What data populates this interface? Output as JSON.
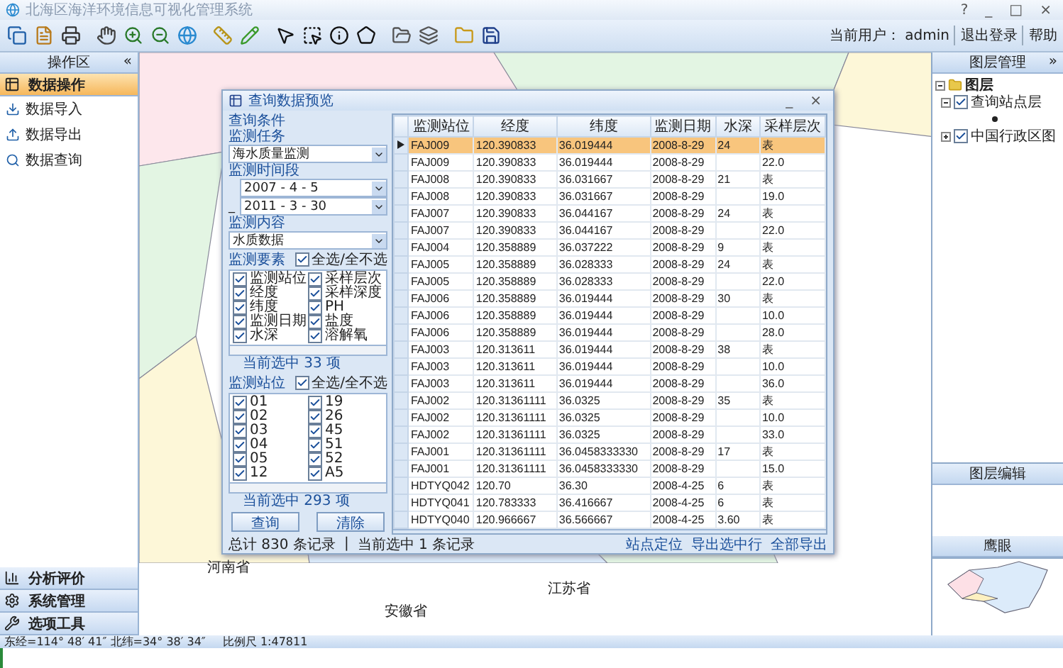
{
  "window": {
    "title": "北海区海洋环境信息可视化管理系统",
    "controls": [
      "?",
      "_",
      "□",
      "×"
    ]
  },
  "toolbar": {
    "user_label": "当前用户：",
    "user": "admin",
    "links": [
      "退出登录",
      "帮助"
    ]
  },
  "left_panel": {
    "title": "操作区",
    "collapse": "«",
    "sections": [
      {
        "label": "数据操作",
        "selected": true,
        "items": [
          "数据导入",
          "数据导出",
          "数据查询"
        ]
      },
      {
        "label": "分析评价",
        "selected": false
      },
      {
        "label": "系统管理",
        "selected": false
      },
      {
        "label": "选项工具",
        "selected": false
      }
    ]
  },
  "map": {
    "labels": [
      "河南省",
      "安徽省",
      "江苏省"
    ]
  },
  "dialog": {
    "title": "查询数据预览",
    "controls": [
      "_",
      "×"
    ],
    "query_title": "查询条件",
    "task_label": "监测任务",
    "task": "海水质量监测",
    "period_label": "监测时间段",
    "start": "2007 - 4 - 5",
    "end": "2011 - 3 - 30",
    "dash": "_",
    "content_label": "监测内容",
    "content": "水质数据",
    "elements": {
      "label": "监测要素",
      "all_label": "全选/全不选",
      "all_checked": true,
      "items": [
        {
          "label": "监测站位",
          "checked": true
        },
        {
          "label": "采样层次",
          "checked": true
        },
        {
          "label": "经度",
          "checked": true
        },
        {
          "label": "采样深度",
          "checked": true
        },
        {
          "label": "纬度",
          "checked": true
        },
        {
          "label": "PH",
          "checked": true
        },
        {
          "label": "监测日期",
          "checked": true
        },
        {
          "label": "盐度",
          "checked": true
        },
        {
          "label": "水深",
          "checked": true
        },
        {
          "label": "溶解氧",
          "checked": true
        }
      ],
      "count": "当前选中 33 项"
    },
    "stations": {
      "label": "监测站位",
      "all_label": "全选/全不选",
      "all_checked": true,
      "items": [
        {
          "label": "01",
          "checked": true
        },
        {
          "label": "19",
          "checked": true
        },
        {
          "label": "02",
          "checked": true
        },
        {
          "label": "26",
          "checked": true
        },
        {
          "label": "03",
          "checked": true
        },
        {
          "label": "45",
          "checked": true
        },
        {
          "label": "04",
          "checked": true
        },
        {
          "label": "51",
          "checked": true
        },
        {
          "label": "05",
          "checked": true
        },
        {
          "label": "52",
          "checked": true
        },
        {
          "label": "12",
          "checked": true
        },
        {
          "label": "A5",
          "checked": true
        }
      ],
      "count": "当前选中 293 项"
    },
    "buttons": [
      "查询",
      "清除"
    ],
    "table": {
      "columns": [
        "监测站位",
        "经度",
        "纬度",
        "监测日期",
        "水深",
        "采样层次"
      ],
      "rows": [
        {
          "selected": true,
          "cells": [
            "FAJ009",
            "120.390833",
            "36.019444",
            "2008-8-29",
            "24",
            "表"
          ]
        },
        {
          "selected": false,
          "cells": [
            "FAJ009",
            "120.390833",
            "36.019444",
            "2008-8-29",
            "",
            "22.0"
          ]
        },
        {
          "selected": false,
          "cells": [
            "FAJ008",
            "120.390833",
            "36.031667",
            "2008-8-29",
            "21",
            "表"
          ]
        },
        {
          "selected": false,
          "cells": [
            "FAJ008",
            "120.390833",
            "36.031667",
            "2008-8-29",
            "",
            "19.0"
          ]
        },
        {
          "selected": false,
          "cells": [
            "FAJ007",
            "120.390833",
            "36.044167",
            "2008-8-29",
            "24",
            "表"
          ]
        },
        {
          "selected": false,
          "cells": [
            "FAJ007",
            "120.390833",
            "36.044167",
            "2008-8-29",
            "",
            "22.0"
          ]
        },
        {
          "selected": false,
          "cells": [
            "FAJ004",
            "120.358889",
            "36.037222",
            "2008-8-29",
            "9",
            "表"
          ]
        },
        {
          "selected": false,
          "cells": [
            "FAJ005",
            "120.358889",
            "36.028333",
            "2008-8-29",
            "24",
            "表"
          ]
        },
        {
          "selected": false,
          "cells": [
            "FAJ005",
            "120.358889",
            "36.028333",
            "2008-8-29",
            "",
            "22.0"
          ]
        },
        {
          "selected": false,
          "cells": [
            "FAJ006",
            "120.358889",
            "36.019444",
            "2008-8-29",
            "30",
            "表"
          ]
        },
        {
          "selected": false,
          "cells": [
            "FAJ006",
            "120.358889",
            "36.019444",
            "2008-8-29",
            "",
            "10.0"
          ]
        },
        {
          "selected": false,
          "cells": [
            "FAJ006",
            "120.358889",
            "36.019444",
            "2008-8-29",
            "",
            "28.0"
          ]
        },
        {
          "selected": false,
          "cells": [
            "FAJ003",
            "120.313611",
            "36.019444",
            "2008-8-29",
            "38",
            "表"
          ]
        },
        {
          "selected": false,
          "cells": [
            "FAJ003",
            "120.313611",
            "36.019444",
            "2008-8-29",
            "",
            "10.0"
          ]
        },
        {
          "selected": false,
          "cells": [
            "FAJ003",
            "120.313611",
            "36.019444",
            "2008-8-29",
            "",
            "36.0"
          ]
        },
        {
          "selected": false,
          "cells": [
            "FAJ002",
            "120.31361111",
            "36.0325",
            "2008-8-29",
            "35",
            "表"
          ]
        },
        {
          "selected": false,
          "cells": [
            "FAJ002",
            "120.31361111",
            "36.0325",
            "2008-8-29",
            "",
            "10.0"
          ]
        },
        {
          "selected": false,
          "cells": [
            "FAJ002",
            "120.31361111",
            "36.0325",
            "2008-8-29",
            "",
            "33.0"
          ]
        },
        {
          "selected": false,
          "cells": [
            "FAJ001",
            "120.31361111",
            "36.0458333330",
            "2008-8-29",
            "17",
            "表"
          ]
        },
        {
          "selected": false,
          "cells": [
            "FAJ001",
            "120.31361111",
            "36.0458333330",
            "2008-8-29",
            "",
            "15.0"
          ]
        },
        {
          "selected": false,
          "cells": [
            "HDTYQ042",
            "120.70",
            "36.30",
            "2008-4-25",
            "6",
            "表"
          ]
        },
        {
          "selected": false,
          "cells": [
            "HDTYQ041",
            "120.783333",
            "36.416667",
            "2008-4-25",
            "6",
            "表"
          ]
        },
        {
          "selected": false,
          "cells": [
            "HDTYQ040",
            "120.966667",
            "36.566667",
            "2008-4-25",
            "3.60",
            "表"
          ]
        }
      ]
    },
    "footer": {
      "total": "总计 830 条记录",
      "separator": "|",
      "current": "当前选中 1 条记录",
      "actions": [
        "站点定位",
        "导出选中行",
        "全部导出"
      ]
    }
  },
  "right_panel": {
    "layers_title": "图层管理",
    "collapse": "»",
    "tree": [
      {
        "label": "图层",
        "expanded": true,
        "children": [
          {
            "label": "查询站点层",
            "checked": true,
            "expanded": true
          },
          {
            "label": "中国行政区图",
            "checked": true,
            "expanded": false
          }
        ]
      }
    ],
    "edit_title": "图层编辑",
    "overview_title": "鹰眼"
  },
  "status_bar": {
    "coords": "东经=114° 48′ 41″ 北纬=34° 38′ 34″",
    "scale": "比例尺 1:47811"
  }
}
